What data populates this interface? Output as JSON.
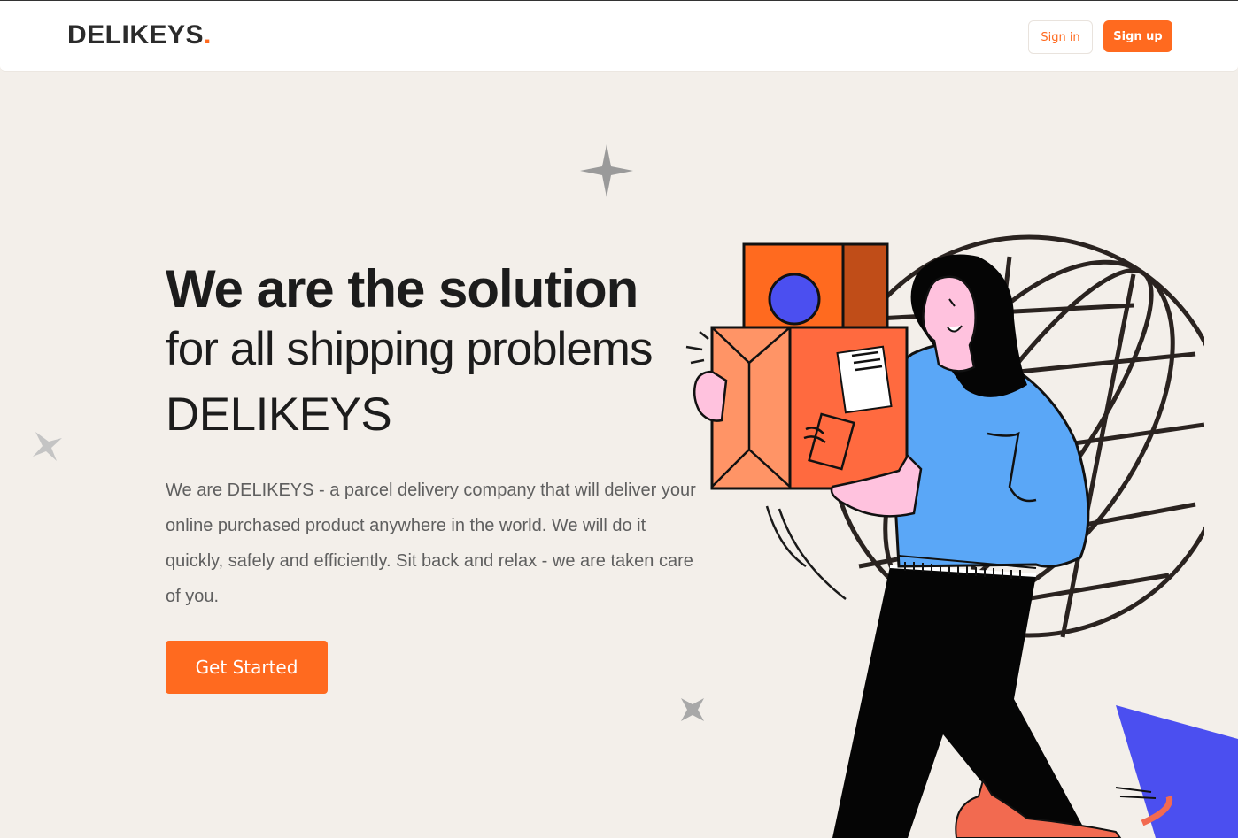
{
  "header": {
    "logo_text": "DELIKEYS",
    "logo_dot": ".",
    "signin_label": "Sign in",
    "signup_label": "Sign up"
  },
  "hero": {
    "title": "We are the solution",
    "subtitle": "for all shipping problems",
    "brand": "DELIKEYS",
    "description": "We are DELIKEYS - a parcel delivery company that will deliver your online purchased product anywhere in the world. We will do it quickly, safely and efficiently. Sit back and relax - we are taken care of you.",
    "cta_label": "Get Started"
  },
  "colors": {
    "accent": "#ff6a1f",
    "background": "#f3efea",
    "text_dark": "#1c1c1c",
    "text_muted": "#5f5f5f",
    "illustration_blue": "#5aa7f7",
    "illustration_indigo": "#4b4ff0"
  },
  "icons": [
    "sparkle-star-icon",
    "globe-icon",
    "delivery-person-illustration",
    "cat-illustration"
  ]
}
